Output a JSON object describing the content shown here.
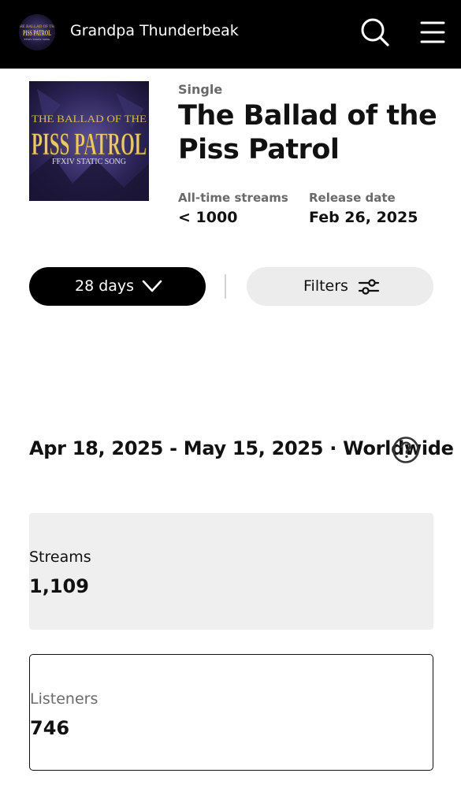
{
  "header": {
    "artist_name": "Grandpa Thunderbeak",
    "search_icon": "search-icon",
    "menu_icon": "hamburger-menu-icon"
  },
  "song": {
    "type": "Single",
    "title": "The Ballad of the Piss Patrol",
    "cover_art": {
      "line1": "THE BALLAD OF THE",
      "line2": "PISS PATROL",
      "line3": "FFXIV STATIC SONG"
    },
    "stats": [
      {
        "label": "All-time streams",
        "value": "< 1000"
      },
      {
        "label": "Release date",
        "value": "Feb 26, 2025"
      }
    ]
  },
  "controls": {
    "period_label": "28 days",
    "filters_label": "Filters"
  },
  "range": {
    "text": "Apr 18, 2025 - May 15, 2025 · Worldwide"
  },
  "metrics": [
    {
      "label": "Streams",
      "value": "1,109"
    },
    {
      "label": "Listeners",
      "value": "746"
    }
  ],
  "colors": {
    "topbar_bg": "#000000",
    "primary_button_bg": "#000000",
    "secondary_button_bg": "#ececec",
    "card_bg": "#efefef",
    "muted_text": "#6a6a6a"
  }
}
